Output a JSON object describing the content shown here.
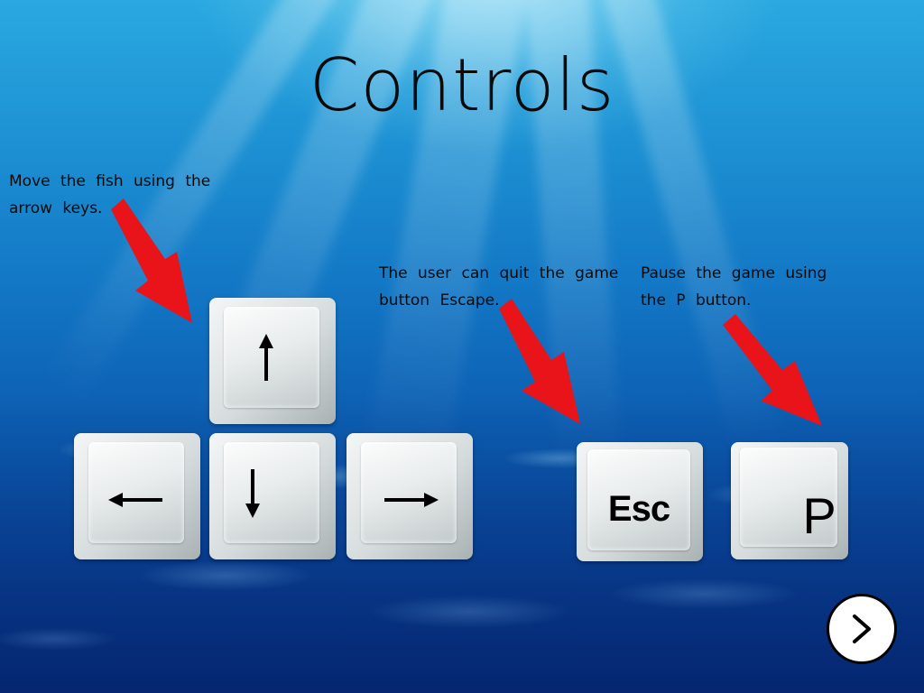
{
  "title": "Controls",
  "captions": {
    "move": "Move the fish using the arrow keys.",
    "quit": "The user can quit the game button Escape.",
    "pause": "Pause the game using the P button."
  },
  "keys": {
    "up": "up-arrow-icon",
    "left": "left-arrow-icon",
    "down": "down-arrow-icon",
    "right": "right-arrow-icon",
    "esc": "Esc",
    "p": "P"
  },
  "next_button": {
    "icon": "chevron-right-icon"
  },
  "colors": {
    "pointer_arrow": "#e8141a",
    "text": "#0a0a0a",
    "water_top": "#2aa8e0",
    "water_bottom": "#07358a"
  }
}
